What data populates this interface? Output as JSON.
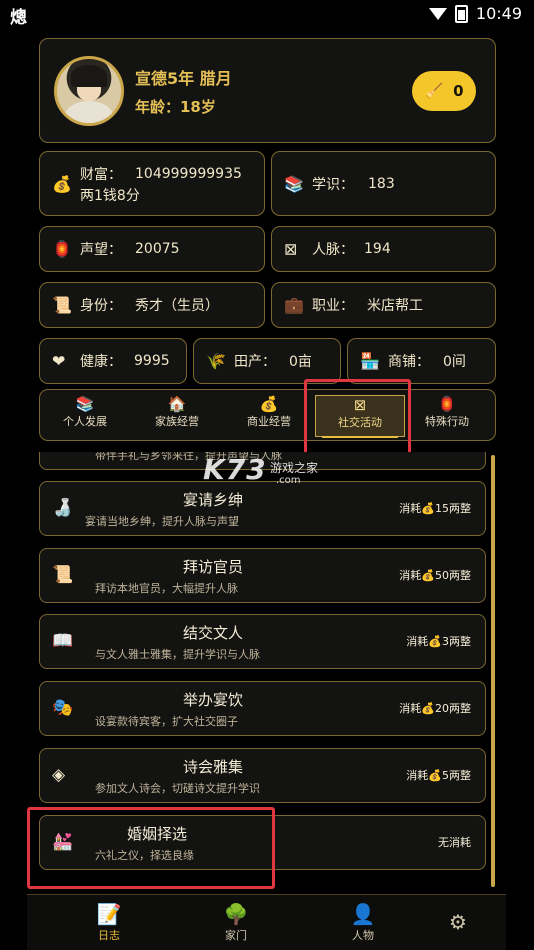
{
  "status_bar": {
    "app_glyph": "熜",
    "time": "10:49"
  },
  "header": {
    "era": "宣德5年 腊月",
    "age": "年龄：18岁",
    "coin_value": "0"
  },
  "stats": {
    "wealth": {
      "label": "财富：",
      "value_line1": "104999999935",
      "value_line2": "两1钱8分"
    },
    "knowledge": {
      "label": "学识：",
      "value": "183"
    },
    "reputation": {
      "label": "声望：",
      "value": "20075"
    },
    "connections": {
      "label": "人脉：",
      "value": "194"
    },
    "identity": {
      "label": "身份：",
      "value": "秀才（生员）"
    },
    "job": {
      "label": "职业：",
      "value": "米店帮工"
    },
    "health": {
      "label": "健康：",
      "value": "9995"
    },
    "land": {
      "label": "田产：",
      "value": "0亩"
    },
    "shops": {
      "label": "商铺：",
      "value": "0间"
    }
  },
  "tabs": [
    {
      "label": "个人发展",
      "icon": "books-icon"
    },
    {
      "label": "家族经营",
      "icon": "house-icon"
    },
    {
      "label": "商业经营",
      "icon": "money-bag-icon"
    },
    {
      "label": "社交活动",
      "icon": "scroll-icon",
      "active": true
    },
    {
      "label": "特殊行动",
      "icon": "lantern-icon"
    }
  ],
  "activities": {
    "partial_desc": "带伴手礼与乡邻来往，提升声望与人脉",
    "items": [
      {
        "title": "宴请乡绅",
        "desc": "宴请当地乡绅，提升人脉与声望",
        "cost": "消耗💰15两整",
        "icon": "bottle-icon"
      },
      {
        "title": "拜访官员",
        "desc": "拜访本地官员，大幅提升人脉",
        "cost": "消耗💰50两整",
        "icon": "scroll-icon"
      },
      {
        "title": "结交文人",
        "desc": "与文人雅士雅集，提升学识与人脉",
        "cost": "消耗💰3两整",
        "icon": "book-icon"
      },
      {
        "title": "举办宴饮",
        "desc": "设宴款待宾客，扩大社交圈子",
        "cost": "消耗💰20两整",
        "icon": "masks-icon"
      },
      {
        "title": "诗会雅集",
        "desc": "参加文人诗会，切磋诗文提升学识",
        "cost": "消耗💰5两整",
        "icon": "mask-icon"
      },
      {
        "title": "婚姻择选",
        "desc": "六礼之仪，择选良缘",
        "cost": "无消耗",
        "icon": "wedding-icon"
      }
    ]
  },
  "watermark": {
    "brand": "K73",
    "site": "游戏之家",
    "domain": ".com"
  },
  "bottom_nav": [
    {
      "label": "日志",
      "icon": "log-icon",
      "active": true
    },
    {
      "label": "家门",
      "icon": "tree-icon"
    },
    {
      "label": "人物",
      "icon": "person-icon"
    },
    {
      "label": "",
      "icon": "settings-icon"
    }
  ]
}
